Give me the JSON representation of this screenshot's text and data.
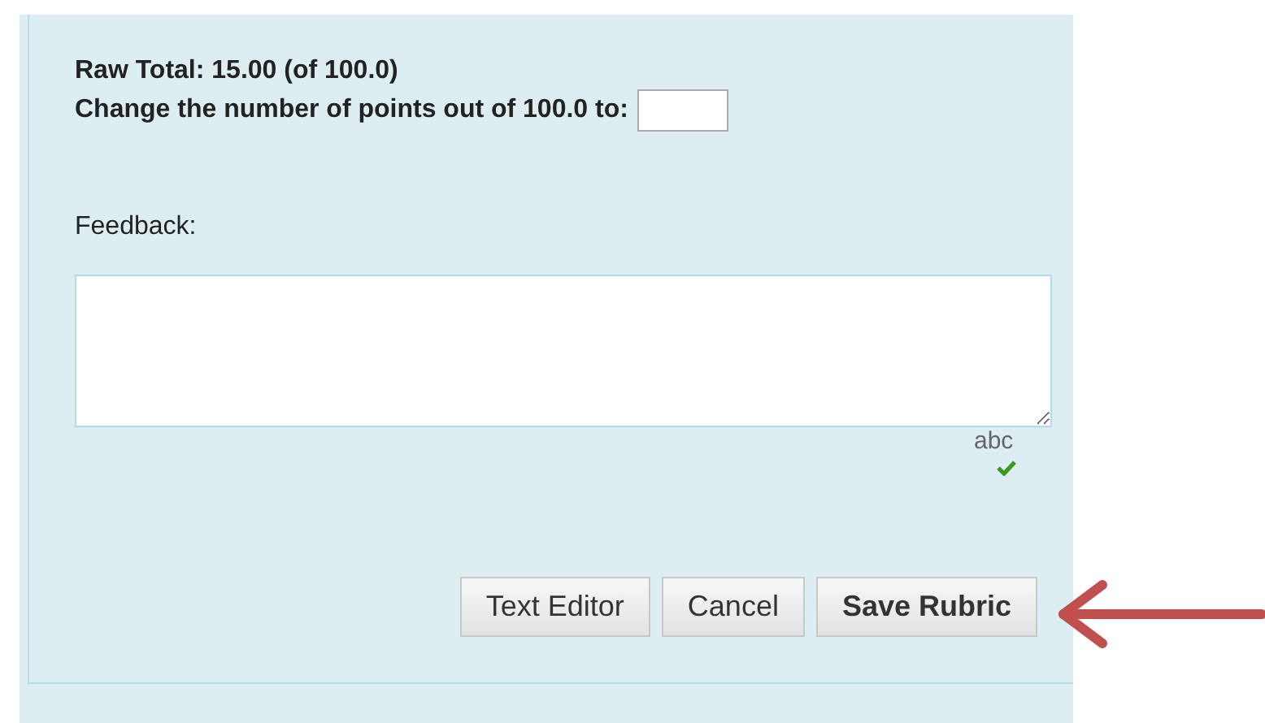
{
  "raw_total": "Raw Total: 15.00 (of 100.0)",
  "change_points": {
    "label": "Change the number of points out of 100.0 to:"
  },
  "feedback": {
    "label": "Feedback:"
  },
  "spellcheck": {
    "text": "abc"
  },
  "buttons": [
    {
      "label": "Text Editor",
      "kind": "default"
    },
    {
      "label": "Cancel",
      "kind": "default"
    },
    {
      "label": "Save Rubric",
      "kind": "primary"
    }
  ],
  "annotation": {
    "kind": "arrow"
  }
}
